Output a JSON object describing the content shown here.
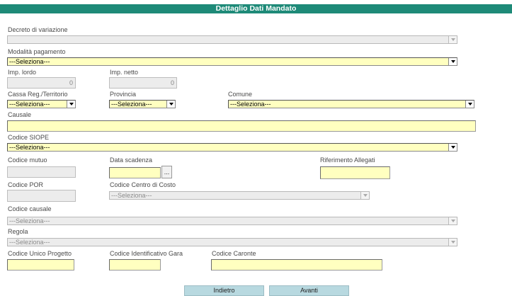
{
  "header": {
    "title": "Dettaglio Dati Mandato"
  },
  "fields": {
    "decreto_variazione": {
      "label": "Decreto di variazione",
      "value": ""
    },
    "modalita_pagamento": {
      "label": "Modalità pagamento",
      "value": "---Seleziona---"
    },
    "imp_lordo": {
      "label": "Imp. lordo",
      "value": "0"
    },
    "imp_netto": {
      "label": "Imp. netto",
      "value": "0"
    },
    "cassa": {
      "label": "Cassa Reg./Territorio",
      "value": "---Seleziona---"
    },
    "provincia": {
      "label": "Provincia",
      "value": "---Seleziona---"
    },
    "comune": {
      "label": "Comune",
      "value": "---Seleziona---"
    },
    "causale": {
      "label": "Causale",
      "value": ""
    },
    "codice_siope": {
      "label": "Codice SIOPE",
      "value": "---Seleziona---"
    },
    "codice_mutuo": {
      "label": "Codice mutuo",
      "value": ""
    },
    "data_scadenza": {
      "label": "Data scadenza",
      "value": "",
      "picker_label": "..."
    },
    "riferimento_allegati": {
      "label": "Riferimento Allegati",
      "value": ""
    },
    "codice_por": {
      "label": "Codice POR",
      "value": ""
    },
    "codice_centro_costo": {
      "label": "Codice Centro di Costo",
      "value": "---Seleziona---"
    },
    "codice_causale": {
      "label": "Codice causale",
      "value": "---Seleziona---"
    },
    "regola": {
      "label": "Regola",
      "value": "---Seleziona---"
    },
    "codice_unico_progetto": {
      "label": "Codice Unico Progetto",
      "value": ""
    },
    "codice_identificativo_gara": {
      "label": "Codice Identificativo Gara",
      "value": ""
    },
    "codice_caronte": {
      "label": "Codice Caronte",
      "value": ""
    }
  },
  "buttons": {
    "back": "Indietro",
    "next": "Avanti"
  },
  "colors": {
    "header_bg": "#1e8a78",
    "field_bg": "#ffffc0",
    "disabled_bg": "#ececec",
    "button_bg": "#b8d9e0"
  }
}
